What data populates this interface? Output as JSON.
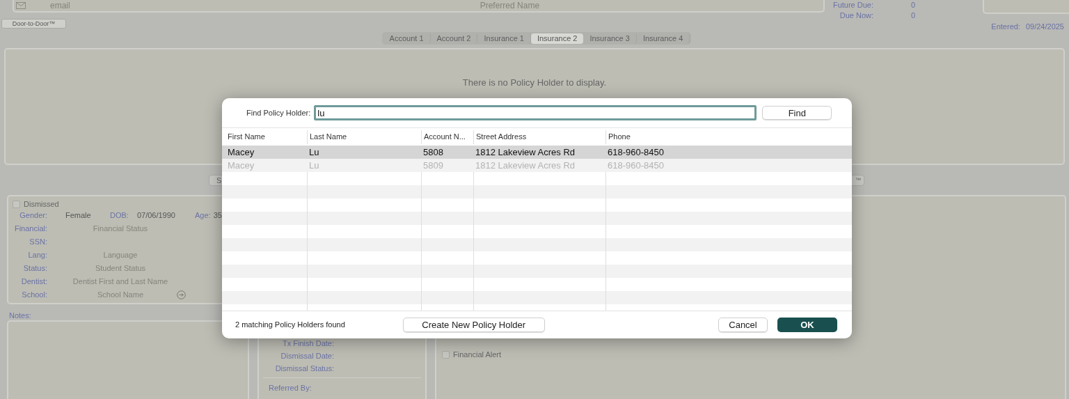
{
  "header": {
    "email_placeholder": "email",
    "preferred_name_placeholder": "Preferred Name",
    "balances": [
      {
        "label": "Future Due:",
        "value": "0"
      },
      {
        "label": "Due Now:",
        "value": "0"
      }
    ],
    "entered": {
      "label": "Entered:",
      "value": "09/24/2025"
    }
  },
  "door_button": "Door-to-Door™",
  "tabs": [
    {
      "label": "Account 1",
      "selected": false
    },
    {
      "label": "Account 2",
      "selected": false
    },
    {
      "label": "Insurance 1",
      "selected": false
    },
    {
      "label": "Insurance 2",
      "selected": true
    },
    {
      "label": "Insurance 3",
      "selected": false
    },
    {
      "label": "Insurance 4",
      "selected": false
    }
  ],
  "policy_holder_panel": {
    "message": "There is no Policy Holder to display."
  },
  "section_bar": {
    "left_fragment": "S",
    "right_fragment": "™"
  },
  "demographics": {
    "dismissed": {
      "label": "Dismissed",
      "checked": false
    },
    "top_row": [
      {
        "label": "Gender:",
        "value": "Female"
      },
      {
        "label": "DOB:",
        "value": "07/06/1990"
      },
      {
        "label": "Age:",
        "value": "35"
      }
    ],
    "fields": [
      {
        "label": "Financial:",
        "placeholder": "Financial Status"
      },
      {
        "label": "SSN:"
      },
      {
        "label": "Lang:",
        "placeholder": "Language"
      },
      {
        "label": "Status:",
        "placeholder": "Student Status"
      },
      {
        "label": "Dentist:",
        "placeholder": "Dentist First and Last Name"
      },
      {
        "label": "School:",
        "placeholder": "School Name",
        "kind": "link"
      }
    ]
  },
  "notes": {
    "label": "Notes:"
  },
  "dates": [
    "Tx Finish Date:",
    "Dismissal Date:",
    "Dismissal Status:"
  ],
  "referred_by": "Referred By:",
  "financial_alert": {
    "label": "Financial Alert",
    "checked": false
  },
  "dialog": {
    "find_label": "Find Policy Holder:",
    "query": "lu",
    "find_button": "Find",
    "columns": [
      "First Name",
      "Last Name",
      "Account N...",
      "Street Address",
      "Phone"
    ],
    "rows": [
      {
        "cells": [
          "Macey",
          "Lu",
          "5808",
          "1812 Lakeview Acres Rd",
          "618-960-8450"
        ],
        "selected": true,
        "inactive": false
      },
      {
        "cells": [
          "Macey",
          "Lu",
          "5809",
          "1812 Lakeview Acres Rd",
          "618-960-8450"
        ],
        "selected": false,
        "inactive": true
      }
    ],
    "status": "2 matching Policy Holders found",
    "create_button": "Create New Policy Holder",
    "cancel_button": "Cancel",
    "ok_button": "OK"
  }
}
